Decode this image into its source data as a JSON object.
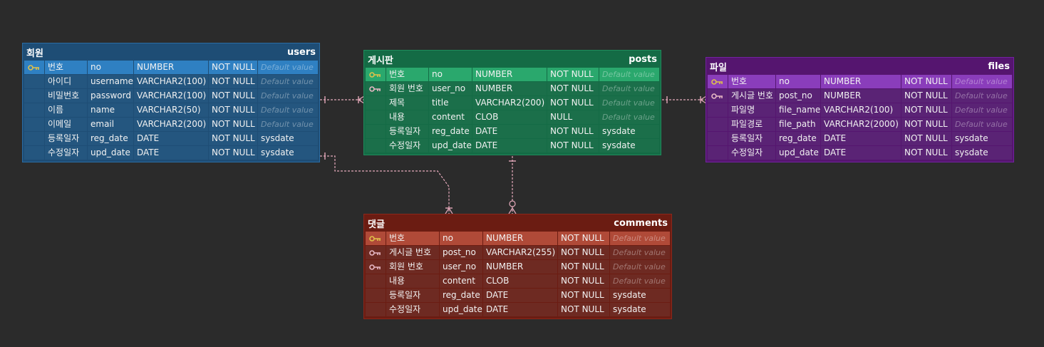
{
  "colors": {
    "background": "#2b2b2b",
    "users": {
      "header": "#1e4d75",
      "border": "#2a6ca3",
      "pk": "#2f80c2",
      "cell": "#24567f"
    },
    "posts": {
      "header": "#146b45",
      "border": "#1f8c5c",
      "pk": "#2aa86d",
      "cell": "#1b6f4a"
    },
    "files": {
      "header": "#55156f",
      "border": "#7222a0",
      "pk": "#8a3dbb",
      "cell": "#5a2375"
    },
    "comments": {
      "header": "#6b1c12",
      "border": "#8c271a",
      "pk": "#b04a38",
      "cell": "#6e2a22"
    },
    "link": "#e4a9ba",
    "pk_icon": "#e0c14a",
    "fk_icon": "#e7b8c4"
  },
  "entities": [
    {
      "id": "users",
      "logical": "회원",
      "physical": "users",
      "theme": "users",
      "rows": [
        {
          "key": "pk",
          "logical": "번호",
          "physical": "no",
          "type": "NUMBER",
          "null": "NOT NULL",
          "default": "Default value"
        },
        {
          "key": "",
          "logical": "아이디",
          "physical": "username",
          "type": "VARCHAR2(100)",
          "null": "NOT NULL",
          "default": "Default value"
        },
        {
          "key": "",
          "logical": "비밀번호",
          "physical": "password",
          "type": "VARCHAR2(100)",
          "null": "NOT NULL",
          "default": "Default value"
        },
        {
          "key": "",
          "logical": "이름",
          "physical": "name",
          "type": "VARCHAR2(50)",
          "null": "NOT NULL",
          "default": "Default value"
        },
        {
          "key": "",
          "logical": "이메일",
          "physical": "email",
          "type": "VARCHAR2(200)",
          "null": "NOT NULL",
          "default": "Default value"
        },
        {
          "key": "",
          "logical": "등록일자",
          "physical": "reg_date",
          "type": "DATE",
          "null": "NOT NULL",
          "default": "sysdate"
        },
        {
          "key": "",
          "logical": "수정일자",
          "physical": "upd_date",
          "type": "DATE",
          "null": "NOT NULL",
          "default": "sysdate"
        }
      ]
    },
    {
      "id": "posts",
      "logical": "게시판",
      "physical": "posts",
      "theme": "posts",
      "rows": [
        {
          "key": "pk",
          "logical": "번호",
          "physical": "no",
          "type": "NUMBER",
          "null": "NOT NULL",
          "default": "Default value"
        },
        {
          "key": "fk",
          "logical": "회원 번호",
          "physical": "user_no",
          "type": "NUMBER",
          "null": "NOT NULL",
          "default": "Default value"
        },
        {
          "key": "",
          "logical": "제목",
          "physical": "title",
          "type": "VARCHAR2(200)",
          "null": "NOT NULL",
          "default": "Default value"
        },
        {
          "key": "",
          "logical": "내용",
          "physical": "content",
          "type": "CLOB",
          "null": "NULL",
          "default": "Default value"
        },
        {
          "key": "",
          "logical": "등록일자",
          "physical": "reg_date",
          "type": "DATE",
          "null": "NOT NULL",
          "default": "sysdate"
        },
        {
          "key": "",
          "logical": "수정일자",
          "physical": "upd_date",
          "type": "DATE",
          "null": "NOT NULL",
          "default": "sysdate"
        }
      ]
    },
    {
      "id": "files",
      "logical": "파일",
      "physical": "files",
      "theme": "files",
      "rows": [
        {
          "key": "pk",
          "logical": "번호",
          "physical": "no",
          "type": "NUMBER",
          "null": "NOT NULL",
          "default": "Default value"
        },
        {
          "key": "fk",
          "logical": "게시글 번호",
          "physical": "post_no",
          "type": "NUMBER",
          "null": "NOT NULL",
          "default": "Default value"
        },
        {
          "key": "",
          "logical": "파일명",
          "physical": "file_name",
          "type": "VARCHAR2(100)",
          "null": "NOT NULL",
          "default": "Default value"
        },
        {
          "key": "",
          "logical": "파일경로",
          "physical": "file_path",
          "type": "VARCHAR2(2000)",
          "null": "NOT NULL",
          "default": "Default value"
        },
        {
          "key": "",
          "logical": "등록일자",
          "physical": "reg_date",
          "type": "DATE",
          "null": "NOT NULL",
          "default": "sysdate"
        },
        {
          "key": "",
          "logical": "수정일자",
          "physical": "upd_date",
          "type": "DATE",
          "null": "NOT NULL",
          "default": "sysdate"
        }
      ]
    },
    {
      "id": "comments",
      "logical": "댓글",
      "physical": "comments",
      "theme": "comments",
      "rows": [
        {
          "key": "pk",
          "logical": "번호",
          "physical": "no",
          "type": "NUMBER",
          "null": "NOT NULL",
          "default": "Default value"
        },
        {
          "key": "fk",
          "logical": "게시글 번호",
          "physical": "post_no",
          "type": "VARCHAR2(255)",
          "null": "NOT NULL",
          "default": "Default value"
        },
        {
          "key": "fk",
          "logical": "회원 번호",
          "physical": "user_no",
          "type": "NUMBER",
          "null": "NOT NULL",
          "default": "Default value"
        },
        {
          "key": "",
          "logical": "내용",
          "physical": "content",
          "type": "CLOB",
          "null": "NOT NULL",
          "default": "Default value"
        },
        {
          "key": "",
          "logical": "등록일자",
          "physical": "reg_date",
          "type": "DATE",
          "null": "NOT NULL",
          "default": "sysdate"
        },
        {
          "key": "",
          "logical": "수정일자",
          "physical": "upd_date",
          "type": "DATE",
          "null": "NOT NULL",
          "default": "sysdate"
        }
      ]
    }
  ],
  "relations": [
    {
      "from": "users",
      "to": "posts",
      "from_end": "one",
      "to_end": "many"
    },
    {
      "from": "posts",
      "to": "files",
      "from_end": "one",
      "to_end": "many"
    },
    {
      "from": "users",
      "to": "comments",
      "from_end": "one",
      "to_end": "many"
    },
    {
      "from": "posts",
      "to": "comments",
      "from_end": "one",
      "to_end": "zero-or-many"
    }
  ]
}
